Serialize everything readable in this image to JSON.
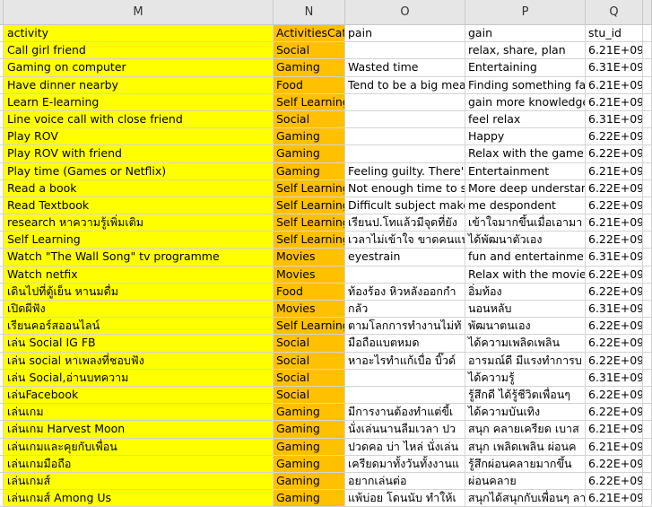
{
  "columns": [
    "M",
    "N",
    "O",
    "P",
    "Q"
  ],
  "headers": {
    "activity": "activity",
    "cat": "ActivitiesCat",
    "pain": "pain",
    "gain": "gain",
    "id": "stu_id"
  },
  "rows": [
    {
      "activity": "Call girl friend",
      "cat": "Social",
      "pain": "",
      "gain": "relax, share, plan",
      "id": "6.21E+09"
    },
    {
      "activity": "Gaming on computer",
      "cat": "Gaming",
      "pain": "Wasted time",
      "gain": "Entertaining",
      "id": "6.31E+09"
    },
    {
      "activity": "Have dinner nearby",
      "cat": "Food",
      "pain": "Tend to be a big meal w",
      "gain": "Finding something fanc",
      "id": "6.21E+09"
    },
    {
      "activity": "Learn E-learning",
      "cat": "Self Learning",
      "pain": "",
      "gain": "gain more knowledge",
      "id": "6.21E+09"
    },
    {
      "activity": "Line voice call with close friend",
      "cat": "Social",
      "pain": "",
      "gain": "feel relax",
      "id": "6.31E+09"
    },
    {
      "activity": "Play ROV",
      "cat": "Gaming",
      "pain": "",
      "gain": "Happy",
      "id": "6.22E+09"
    },
    {
      "activity": "Play ROV with friend",
      "cat": "Gaming",
      "pain": "",
      "gain": "Relax with the game",
      "id": "6.22E+09"
    },
    {
      "activity": "Play time (Games or Netflix)",
      "cat": "Gaming",
      "pain": "Feeling guilty. There's a",
      "gain": "Entertainment",
      "id": "6.21E+09"
    },
    {
      "activity": "Read a book",
      "cat": "Self Learning",
      "pain": "Not enough time to su",
      "gain": "More deep understand",
      "id": "6.22E+09"
    },
    {
      "activity": "Read Textbook",
      "cat": "Self Learning",
      "pain": "Difficult subject makes",
      "gain": "me despondent",
      "id": "6.22E+09"
    },
    {
      "activity": "research หาความรู้เพิ่มเติม",
      "cat": "Self Learning",
      "pain": "เรียนป.โทแล้วมีจุดที่ยัง",
      "gain": "เข้าใจมากขึ้นเมื่อเอามา",
      "id": "6.21E+09"
    },
    {
      "activity": "Self Learning",
      "cat": "Self Learning",
      "pain": "เวลาไม่เข้าใจ ขาดคนแน",
      "gain": "ได้พัฒนาตัวเอง",
      "id": "6.22E+09"
    },
    {
      "activity": "Watch \"The Wall Song\" tv programme",
      "cat": "Movies",
      "pain": "eyestrain",
      "gain": "fun and entertainment",
      "id": "6.31E+09"
    },
    {
      "activity": "Watch netfix",
      "cat": "Movies",
      "pain": "",
      "gain": "Relax with the movie",
      "id": "6.22E+09"
    },
    {
      "activity": "เดินไปที่ตู้เย็น หานมดื่ม",
      "cat": "Food",
      "pain": "ท้องร้อง หิวหลังออกกำ",
      "gain": "อิ่มท้อง",
      "id": "6.22E+09"
    },
    {
      "activity": "เปิดผีฟัง",
      "cat": "Movies",
      "pain": "กลัว",
      "gain": "นอนหลับ",
      "id": "6.31E+09"
    },
    {
      "activity": "เรียนคอร์สออนไลน์",
      "cat": "Self Learning",
      "pain": "ตามโลกการทำงานไม่ทั",
      "gain": "พัฒนาตนเอง",
      "id": "6.22E+09"
    },
    {
      "activity": "เล่น Social IG FB",
      "cat": "Social",
      "pain": "มือถือแบตหมด",
      "gain": "ได้ความเพลิดเพลิน",
      "id": "6.22E+09"
    },
    {
      "activity": "เล่น social หาเพลงที่ชอบฟัง",
      "cat": "Social",
      "pain": "หาอะไรทำแก้เบื่อ บิ๊วด์",
      "gain": "อารมณ์ดี มีแรงทำการบ",
      "id": "6.22E+09"
    },
    {
      "activity": "เล่น Social,อ่านบทความ",
      "cat": "Social",
      "pain": "",
      "gain": "ได้ความรู้",
      "id": "6.31E+09"
    },
    {
      "activity": "เล่นFacebook",
      "cat": "Social",
      "pain": "",
      "gain": "รู้สึกดี ได้รู้ชีวิตเพื่อนๆ",
      "id": "6.22E+09"
    },
    {
      "activity": "เล่นเกม",
      "cat": "Gaming",
      "pain": "มีการงานต้องทำแต่ขี้เ",
      "gain": "ได้ความบันเทิง",
      "id": "6.22E+09"
    },
    {
      "activity": "เล่นเกม Harvest Moon",
      "cat": "Gaming",
      "pain": "นั่งเล่นนานลืมเวลา ปว",
      "gain": "สนุก คลายเครียด เบาส",
      "id": "6.21E+09"
    },
    {
      "activity": "เล่นเกมและคุยกับเพื่อน",
      "cat": "Gaming",
      "pain": "ปวดคอ บ่า ไหล่ นั่งเล่น",
      "gain": "สนุก เพลิดเพลิน ผ่อนค",
      "id": "6.21E+09"
    },
    {
      "activity": "เล่นเกมมือถือ",
      "cat": "Gaming",
      "pain": "เครียดมาทั้งวันทั้งงานแ",
      "gain": "รู้สึกผ่อนคลายมากขึ้น",
      "id": "6.22E+09"
    },
    {
      "activity": "เล่นเกมส์",
      "cat": "Gaming",
      "pain": "อยากเล่นต่อ",
      "gain": "ผ่อนคลาย",
      "id": "6.22E+09"
    },
    {
      "activity": "เล่นเกมส์ Among Us",
      "cat": "Gaming",
      "pain": "แพ้บ่อย โดนนับ ทำให้เ",
      "gain": "สนุกได้สนุกกับเพื่อนๆ ลา",
      "id": "6.21E+09"
    }
  ]
}
